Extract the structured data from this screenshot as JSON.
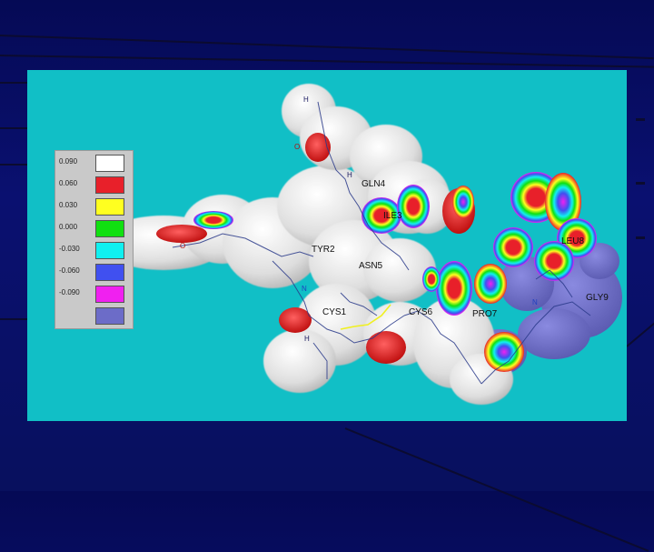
{
  "legend": {
    "items": [
      {
        "label": "0.090",
        "color": "#ffffff"
      },
      {
        "label": "0.060",
        "color": "#e8202a"
      },
      {
        "label": "0.030",
        "color": "#ffff20"
      },
      {
        "label": "0.000",
        "color": "#10e010"
      },
      {
        "label": "-0.030",
        "color": "#10f0f0"
      },
      {
        "label": "-0.060",
        "color": "#4050f0"
      },
      {
        "label": "-0.090",
        "color": "#f020f0"
      },
      {
        "label": "",
        "color": "#6c6cc8"
      }
    ]
  },
  "residues": {
    "gln4": "GLN4",
    "ile3": "ILE3",
    "tyr2": "TYR2",
    "asn5": "ASN5",
    "cys1": "CYS1",
    "cys6": "CYS6",
    "pro7": "PRO7",
    "leu8": "LEU8",
    "gly9": "GLY9"
  },
  "atom_labels": {
    "h1": "H",
    "h2": "H",
    "h3": "H",
    "o1": "O",
    "o2": "O",
    "n1": "N",
    "n2": "N"
  },
  "colors": {
    "slide_bg": "#0a1070",
    "panel_bg": "#11bfc6",
    "surface": "#e2e2e2"
  }
}
